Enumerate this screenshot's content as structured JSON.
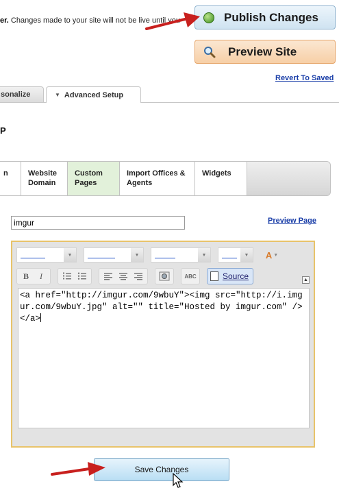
{
  "notice": {
    "bold": "er.",
    "text": " Changes made to your site will not be live until you"
  },
  "buttons": {
    "publish": "Publish Changes",
    "preview": "Preview Site",
    "revert": "Revert To Saved",
    "save": "Save Changes"
  },
  "top_tabs": [
    {
      "label": "sonalize"
    },
    {
      "label": "Advanced Setup"
    }
  ],
  "section_heading": "P",
  "sub_tabs": [
    {
      "label": "n"
    },
    {
      "label": "Website Domain"
    },
    {
      "label": "Custom Pages"
    },
    {
      "label": "Import Offices & Agents"
    },
    {
      "label": "Widgets"
    }
  ],
  "page_name": {
    "value": "imgur",
    "link": "Preview Page"
  },
  "editor": {
    "source_label": "Source",
    "code": "<a href=\"http://imgur.com/9wbuY\"><img src=\"http://i.imgur.com/9wbuY.jpg\" alt=\"\" title=\"Hosted by imgur.com\" /></a>"
  },
  "colors": {
    "publish_bg": "#cfe3f1",
    "preview_bg": "#f7cfa6",
    "active_tab_bg": "#e2f1da",
    "editor_border": "#e8c36a",
    "link": "#1a3ea8",
    "arrow": "#c8201e"
  }
}
